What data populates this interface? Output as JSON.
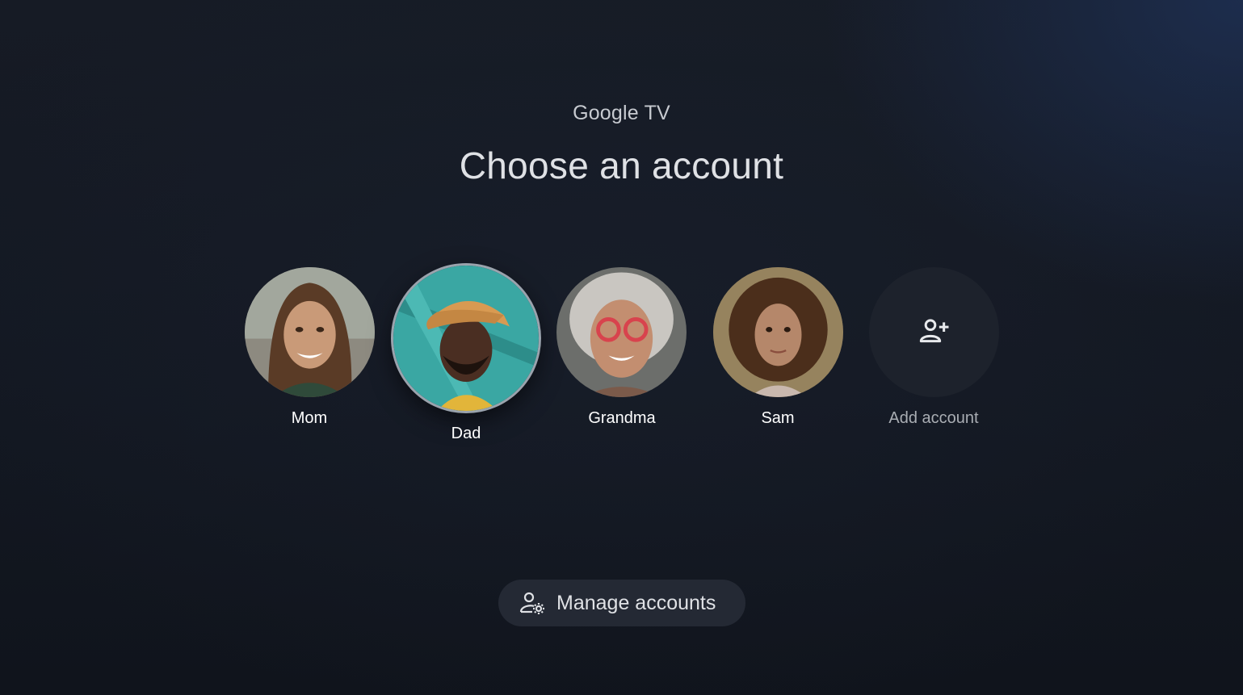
{
  "header": {
    "brand": "Google TV",
    "title": "Choose an account"
  },
  "profiles": [
    {
      "name": "Mom",
      "focused": false
    },
    {
      "name": "Dad",
      "focused": true
    },
    {
      "name": "Grandma",
      "focused": false
    },
    {
      "name": "Sam",
      "focused": false
    }
  ],
  "add_account": {
    "label": "Add account",
    "icon": "person-add-icon"
  },
  "manage": {
    "label": "Manage accounts",
    "icon": "manage-accounts-icon"
  },
  "colors": {
    "background": "#131822",
    "button": "#242934",
    "focus_ring": "#9aa3ad"
  }
}
